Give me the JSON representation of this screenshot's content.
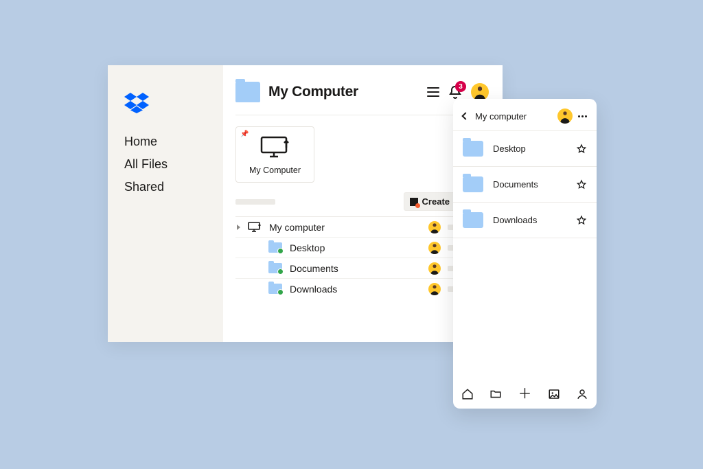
{
  "sidebar": {
    "items": [
      {
        "label": "Home"
      },
      {
        "label": "All Files"
      },
      {
        "label": "Shared"
      }
    ]
  },
  "header": {
    "title": "My Computer",
    "notification_count": "3"
  },
  "device_card": {
    "label": "My Computer"
  },
  "toolbar": {
    "create_label": "Create"
  },
  "files": [
    {
      "name": "My computer"
    },
    {
      "name": "Desktop"
    },
    {
      "name": "Documents"
    },
    {
      "name": "Downloads"
    }
  ],
  "phone": {
    "title": "My computer",
    "items": [
      {
        "name": "Desktop"
      },
      {
        "name": "Documents"
      },
      {
        "name": "Downloads"
      }
    ]
  }
}
